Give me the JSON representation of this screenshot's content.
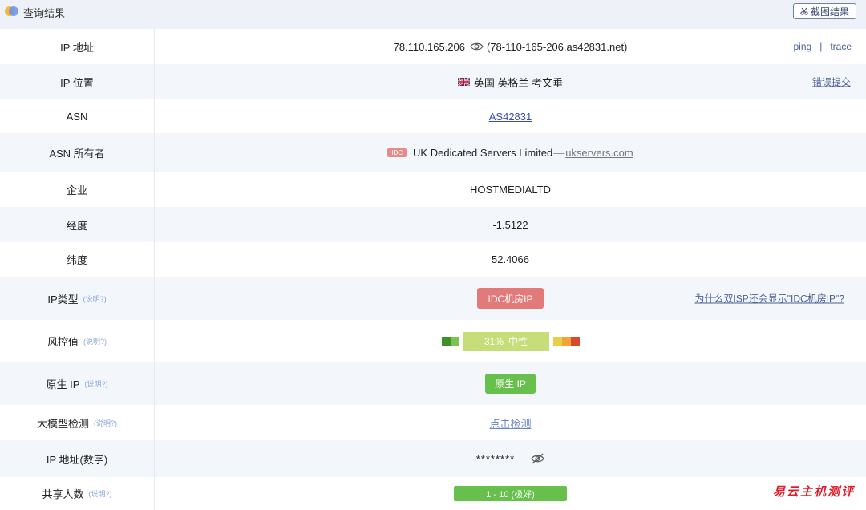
{
  "header": {
    "title": "查询结果",
    "screenshot_label": "截图结果"
  },
  "rows": {
    "ip": {
      "label": "IP 地址",
      "value": "78.110.165.206",
      "hostname": "(78-110-165-206.as42831.net)",
      "ping": "ping",
      "separator": "|",
      "trace": "trace"
    },
    "location": {
      "label": "IP 位置",
      "value": "英国 英格兰 考文垂",
      "report": "错误提交"
    },
    "asn": {
      "label": "ASN",
      "value": "AS42831"
    },
    "asn_owner": {
      "label": "ASN 所有者",
      "tag": "IDC",
      "value": "UK Dedicated Servers Limited",
      "dash": "—",
      "domain": "ukservers.com"
    },
    "company": {
      "label": "企业",
      "value": "HOSTMEDIALTD"
    },
    "longitude": {
      "label": "经度",
      "value": "-1.5122"
    },
    "latitude": {
      "label": "纬度",
      "value": "52.4066"
    },
    "ip_type": {
      "label": "IP类型",
      "help": "(说明?)",
      "value": "IDC机房IP",
      "faq": "为什么双ISP还会显示\"IDC机房IP\"?"
    },
    "risk": {
      "label": "风控值",
      "help": "(说明?)",
      "percent": "31%",
      "level": "中性",
      "score": 0.31
    },
    "native_ip": {
      "label": "原生 IP",
      "help": "(说明?)",
      "value": "原生 IP"
    },
    "llm": {
      "label": "大模型检测",
      "help": "(说明?)",
      "value": "点击检测"
    },
    "ip_numeric": {
      "label": "IP 地址(数字)",
      "value": "********"
    },
    "shared": {
      "label": "共享人数",
      "help": "(说明?)",
      "value": "1 - 10 (极好)"
    }
  },
  "watermark": "易云主机测评",
  "colors": {
    "header_bg": "#eef1f7",
    "row_alt_bg": "#f3f6fb",
    "badge_red": "#e27a7a",
    "badge_green": "#66c04b",
    "risk_neutral": "#c6dd7a",
    "link": "#3b4db5",
    "watermark": "#e21b2a"
  },
  "icons": {
    "logo": "two-circle-logo-icon",
    "screenshot": "scissors-icon",
    "reveal": "eye-icon",
    "hide": "eye-slash-icon",
    "flag": "uk-flag-icon"
  }
}
